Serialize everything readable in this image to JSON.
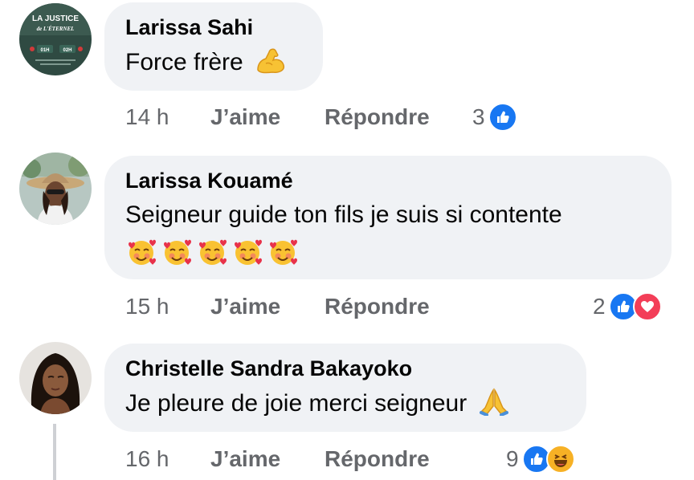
{
  "comments": [
    {
      "author": "Larissa Sahi",
      "text": "Force frère",
      "emoji_icons": [
        "flexed-biceps-icon"
      ],
      "avatar": {
        "line1": "LA JUSTICE",
        "line2": "de L'ÉTERNEL",
        "left_badge": "01H",
        "right_badge": "02H"
      },
      "time": "14 h",
      "like_label": "J’aime",
      "reply_label": "Répondre",
      "reaction_count": "3",
      "reactions": [
        "like-reaction-icon"
      ]
    },
    {
      "author": "Larissa Kouamé",
      "text": "Seigneur guide ton fils je suis si contente",
      "emoji_icons": [
        "smiling-face-with-hearts-icon",
        "smiling-face-with-hearts-icon",
        "smiling-face-with-hearts-icon",
        "smiling-face-with-hearts-icon",
        "smiling-face-with-hearts-icon"
      ],
      "time": "15 h",
      "like_label": "J’aime",
      "reply_label": "Répondre",
      "reaction_count": "2",
      "reactions": [
        "like-reaction-icon",
        "love-reaction-icon"
      ]
    },
    {
      "author": "Christelle Sandra Bakayoko",
      "text": "Je pleure de joie merci seigneur",
      "emoji_icons": [
        "folded-hands-icon"
      ],
      "time": "16 h",
      "like_label": "J’aime",
      "reply_label": "Répondre",
      "reaction_count": "9",
      "reactions": [
        "like-reaction-icon",
        "haha-reaction-icon"
      ]
    }
  ],
  "colors": {
    "bubble": "#f0f2f5",
    "meta_text": "#65676b",
    "like_blue": "#1877f2",
    "love_red": "#f33e58",
    "haha_yellow": "#f7b125"
  }
}
